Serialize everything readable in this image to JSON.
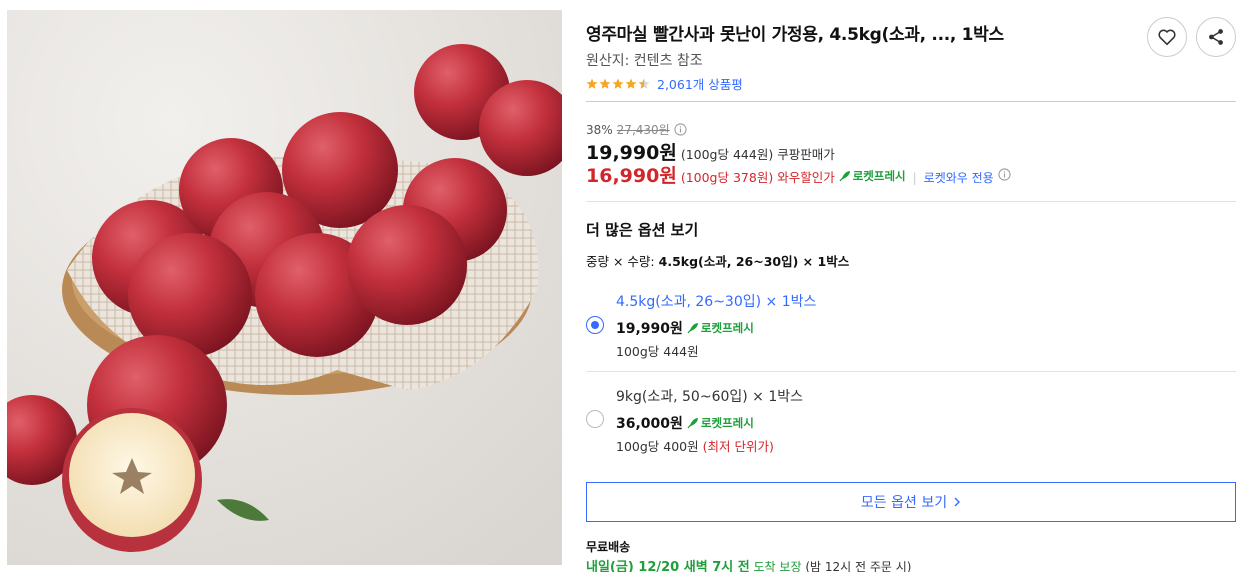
{
  "product": {
    "title": "영주마실 빨간사과 못난이 가정용, 4.5kg(소과, ..., 1박스",
    "origin": "원산지: 컨텐츠 참조",
    "rating_stars": 4.5,
    "review_count": "2,061개 상품평"
  },
  "pricing": {
    "discount_rate": "38%",
    "original_price": "27,430원",
    "sale_price": "19,990원",
    "sale_unit_price": "(100g당 444원)",
    "sale_label": "쿠팡판매가",
    "wow_price": "16,990원",
    "wow_unit_price": "(100g당 378원)",
    "wow_label": "와우할인가",
    "rocket_fresh": "로켓프레시",
    "wow_only": "로켓와우 전용"
  },
  "options": {
    "section_title": "더 많은 옵션 보기",
    "summary_prefix": "중량 × 수량:",
    "summary_value": "4.5kg(소과, 26~30입) × 1박스",
    "items": [
      {
        "name": "4.5kg(소과, 26~30입) × 1박스",
        "price": "19,990원",
        "badge": "로켓프레시",
        "unit": "100g당 444원",
        "note": "",
        "selected": true
      },
      {
        "name": "9kg(소과, 50~60입) × 1박스",
        "price": "36,000원",
        "badge": "로켓프레시",
        "unit": "100g당 400원",
        "note": "(최저 단위가)",
        "selected": false
      }
    ],
    "all_options_label": "모든 옵션 보기"
  },
  "delivery": {
    "title": "무료배송",
    "date": "내일(금) 12/20 새벽 7시 전",
    "guarantee": "도착 보장",
    "note": "(밤 12시 전 주문 시)"
  },
  "colors": {
    "accent_blue": "#346aff",
    "price_red": "#d3262c",
    "rocket_green": "#1d9f3a",
    "star_orange": "#f5a623"
  },
  "icons": [
    "heart-icon",
    "share-icon",
    "star-icon",
    "info-icon",
    "rocket-icon",
    "chevron-right-icon"
  ]
}
